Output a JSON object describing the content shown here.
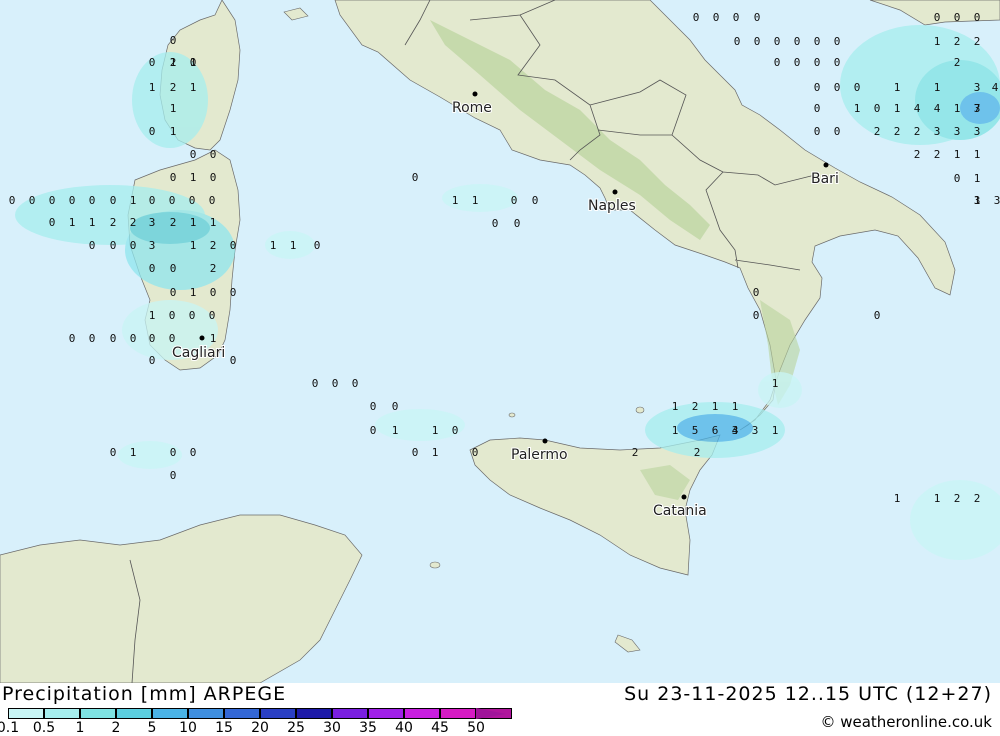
{
  "header": {
    "title": "Precipitation [mm] ARPEGE",
    "valid_time": "Su 23-11-2025 12..15 UTC (12+27)",
    "credit": "© weatheronline.co.uk"
  },
  "legend": {
    "items": [
      {
        "label": "0.1",
        "color": "#c8f5f5"
      },
      {
        "label": "0.5",
        "color": "#a6eeee"
      },
      {
        "label": "1",
        "color": "#7fe3e3"
      },
      {
        "label": "2",
        "color": "#5ccfe0"
      },
      {
        "label": "5",
        "color": "#4bb3e6"
      },
      {
        "label": "10",
        "color": "#3f8fe0"
      },
      {
        "label": "15",
        "color": "#3367d6"
      },
      {
        "label": "20",
        "color": "#2a3fc4"
      },
      {
        "label": "25",
        "color": "#1d1aa8"
      },
      {
        "label": "30",
        "color": "#7a1fe0"
      },
      {
        "label": "35",
        "color": "#a020e8"
      },
      {
        "label": "40",
        "color": "#c81ee0"
      },
      {
        "label": "45",
        "color": "#d61bc4"
      },
      {
        "label": "50",
        "color": "#b0159c"
      }
    ]
  },
  "cities": [
    {
      "name": "Rome"
    },
    {
      "name": "Naples"
    },
    {
      "name": "Bari"
    },
    {
      "name": "Cagliari"
    },
    {
      "name": "Palermo"
    },
    {
      "name": "Catania"
    }
  ],
  "map_values": [
    "0",
    "0",
    "0",
    "0",
    "0",
    "0",
    "0",
    "0",
    "0",
    "0",
    "0",
    "0",
    "0",
    "0",
    "0",
    "0",
    "0",
    "0",
    "0",
    "0",
    "0",
    "0",
    "0",
    "0",
    "0",
    "0",
    "0",
    "0",
    "0",
    "0",
    "0",
    "0",
    "0",
    "0",
    "0",
    "0",
    "0",
    "0",
    "0",
    "0",
    "0",
    "0",
    "0",
    "0",
    "0",
    "0",
    "0",
    "0",
    "0",
    "0",
    "0",
    "0",
    "0",
    "0",
    "0",
    "0",
    "0",
    "0",
    "0",
    "0",
    "0",
    "0",
    "0",
    "0",
    "0",
    "0",
    "0",
    "0",
    "0",
    "0",
    "0",
    "0",
    "0",
    "0",
    "0",
    "0",
    "0",
    "0",
    "0",
    "0",
    "0",
    "0",
    "0",
    "0",
    "0",
    "0",
    "1",
    "1",
    "1",
    "1",
    "1",
    "1",
    "1",
    "1",
    "1",
    "1",
    "1",
    "1",
    "1",
    "1",
    "1",
    "1",
    "1",
    "1",
    "1",
    "1",
    "1",
    "1",
    "1",
    "1",
    "1",
    "1",
    "1",
    "1",
    "1",
    "1",
    "1",
    "1",
    "1",
    "1",
    "1",
    "1",
    "1",
    "1",
    "1",
    "1",
    "1",
    "1",
    "2",
    "2",
    "2",
    "2",
    "2",
    "2",
    "2",
    "2",
    "2",
    "2",
    "2",
    "2",
    "2",
    "2",
    "2",
    "2",
    "2",
    "2",
    "2",
    "2",
    "3",
    "3",
    "3",
    "3",
    "3",
    "3",
    "3",
    "3",
    "3",
    "3",
    "3",
    "4",
    "4",
    "4",
    "4",
    "5",
    "6",
    "7",
    "8"
  ],
  "colors": {
    "sea": "#d8f0fb",
    "land": "#e6ead2",
    "precip_light": "#c8f5f5",
    "precip_mid": "#8fe6ee",
    "precip_dark": "#4bb3e6"
  }
}
